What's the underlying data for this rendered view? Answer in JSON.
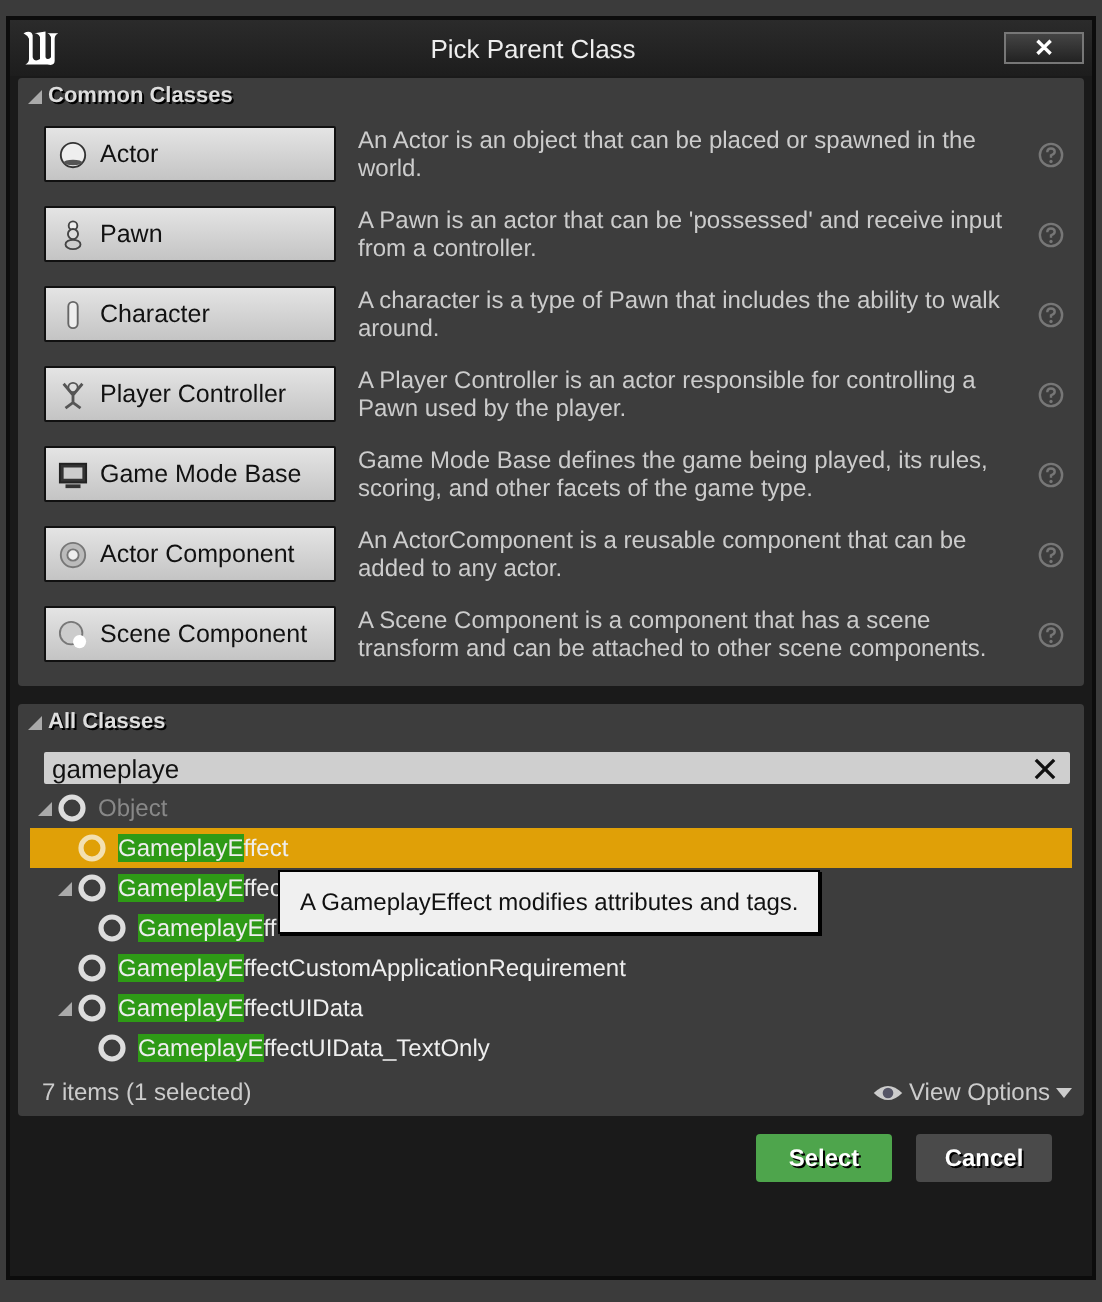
{
  "window": {
    "title": "Pick Parent Class",
    "close": "✕"
  },
  "common_classes": {
    "header": "Common Classes",
    "expanded": true,
    "items": [
      {
        "label": "Actor",
        "description": "An Actor is an object that can be placed or spawned in the world."
      },
      {
        "label": "Pawn",
        "description": "A Pawn is an actor that can be 'possessed' and receive input from a controller."
      },
      {
        "label": "Character",
        "description": "A character is a type of Pawn that includes the ability to walk around."
      },
      {
        "label": "Player Controller",
        "description": "A Player Controller is an actor responsible for controlling a Pawn used by the player."
      },
      {
        "label": "Game Mode Base",
        "description": "Game Mode Base defines the game being played, its rules, scoring, and other facets of the game type."
      },
      {
        "label": "Actor Component",
        "description": "An ActorComponent is a reusable component that can be added to any actor."
      },
      {
        "label": "Scene Component",
        "description": "A Scene Component is a component that has a scene transform and can be attached to other scene components."
      }
    ]
  },
  "all_classes": {
    "header": "All Classes",
    "expanded": true,
    "search": {
      "value": "gameplaye"
    },
    "tree": [
      {
        "name": "Object",
        "dimmed": true,
        "selected": false,
        "expanded": true,
        "children": [
          {
            "match": "GameplayE",
            "name": "ffect",
            "dimmed": false,
            "selected": true
          },
          {
            "match": "GameplayE",
            "name": "ffec",
            "dimmed": false,
            "selected": false,
            "expanded": true,
            "children": [
              {
                "match": "GameplayE",
                "name": "ff",
                "dimmed": false,
                "selected": false
              }
            ]
          },
          {
            "match": "GameplayE",
            "name": "ffectCustomApplicationRequirement",
            "dimmed": false,
            "selected": false
          },
          {
            "match": "GameplayE",
            "name": "ffectUIData",
            "dimmed": false,
            "selected": false,
            "expanded": true,
            "children": [
              {
                "match": "GameplayE",
                "name": "ffectUIData_TextOnly",
                "dimmed": false,
                "selected": false
              }
            ]
          }
        ]
      }
    ],
    "tooltip": "A GameplayEffect modifies attributes and tags.",
    "status": "7 items (1 selected)",
    "view_options": "View Options"
  },
  "buttons": [
    {
      "label": "Select",
      "kind": "primary"
    },
    {
      "label": "Cancel",
      "kind": "secondary"
    }
  ]
}
